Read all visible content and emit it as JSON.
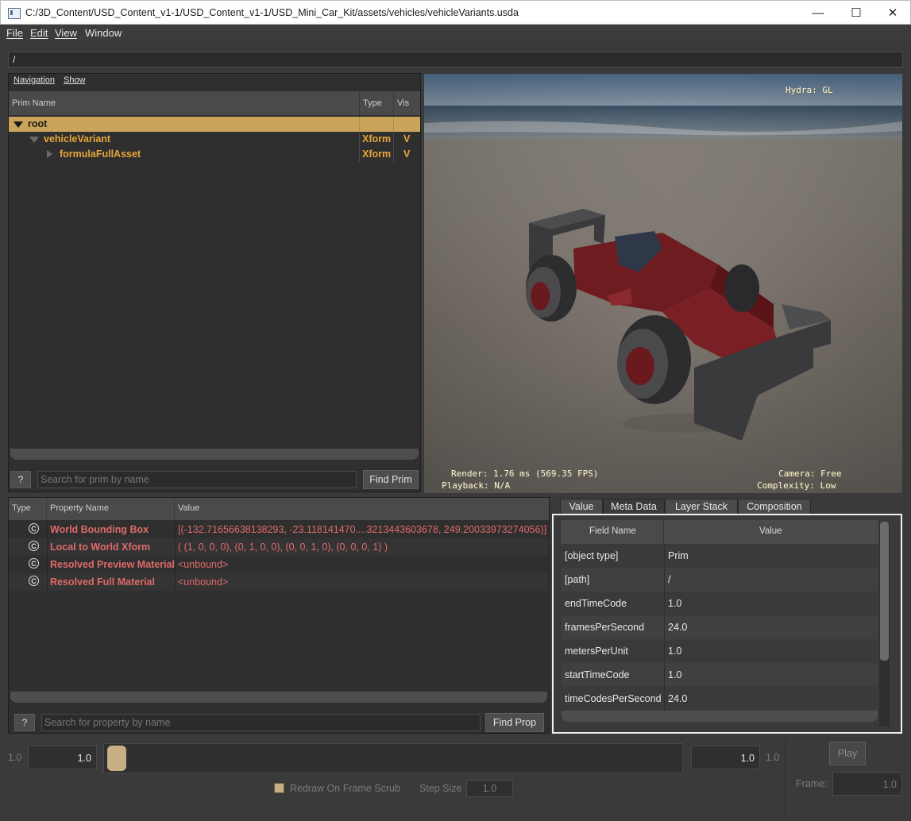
{
  "window": {
    "title": "C:/3D_Content/USD_Content_v1-1/USD_Content_v1-1/USD_Mini_Car_Kit/assets/vehicles/vehicleVariants.usda",
    "minimize": "—",
    "maximize": "☐",
    "close": "✕"
  },
  "menu": {
    "file": "File",
    "edit": "Edit",
    "view": "View",
    "window": "Window"
  },
  "path": "/",
  "tree": {
    "tabs": {
      "navigation": "Navigation",
      "show": "Show"
    },
    "headers": {
      "name": "Prim Name",
      "type": "Type",
      "vis": "Vis"
    },
    "rows": [
      {
        "name": "root",
        "type": "",
        "vis": ""
      },
      {
        "name": "vehicleVariant",
        "type": "Xform",
        "vis": "V"
      },
      {
        "name": "formulaFullAsset",
        "type": "Xform",
        "vis": "V"
      }
    ],
    "help": "?",
    "search_placeholder": "Search for prim by name",
    "find_button": "Find Prim"
  },
  "viewport": {
    "hydra": "Hydra: GL",
    "render": "Render: 1.76 ms (569.35 FPS)",
    "playback": "Playback: N/A",
    "camera": "Camera: Free",
    "complexity": "Complexity: Low"
  },
  "properties": {
    "headers": {
      "type": "Type",
      "name": "Property Name",
      "value": "Value"
    },
    "icon_glyph": "C",
    "rows": [
      {
        "name": "World Bounding Box",
        "value": "[(-132.71656638138293, -23.118141470....3213443603678, 249.20033973274056)]"
      },
      {
        "name": "Local to World Xform",
        "value": "( (1, 0, 0, 0), (0, 1, 0, 0), (0, 0, 1, 0), (0, 0, 0, 1) )"
      },
      {
        "name": "Resolved Preview Material",
        "value": "<unbound>"
      },
      {
        "name": "Resolved Full Material",
        "value": "<unbound>"
      }
    ],
    "help": "?",
    "search_placeholder": "Search for property by name",
    "find_button": "Find Prop"
  },
  "metadata": {
    "tabs": [
      "Value",
      "Meta Data",
      "Layer Stack",
      "Composition"
    ],
    "active_tab": "Meta Data",
    "headers": {
      "field": "Field Name",
      "value": "Value"
    },
    "rows": [
      {
        "field": "[object type]",
        "value": "Prim"
      },
      {
        "field": "[path]",
        "value": "/"
      },
      {
        "field": "endTimeCode",
        "value": "1.0"
      },
      {
        "field": "framesPerSecond",
        "value": "24.0"
      },
      {
        "field": "metersPerUnit",
        "value": "1.0"
      },
      {
        "field": "startTimeCode",
        "value": "1.0"
      },
      {
        "field": "timeCodesPerSecond",
        "value": "24.0"
      }
    ]
  },
  "timeline": {
    "range_start_label": "1.0",
    "start_value": "1.0",
    "end_value": "1.0",
    "range_end_label": "1.0",
    "play": "Play",
    "redraw_label": "Redraw On Frame Scrub",
    "step_size_label": "Step Size",
    "step_size_value": "1.0",
    "frame_label": "Frame:",
    "frame_value": "1.0"
  },
  "colors": {
    "accent_selected": "#c9a45a",
    "prim_text": "#e8a63a",
    "property_text": "#e06a6a"
  }
}
